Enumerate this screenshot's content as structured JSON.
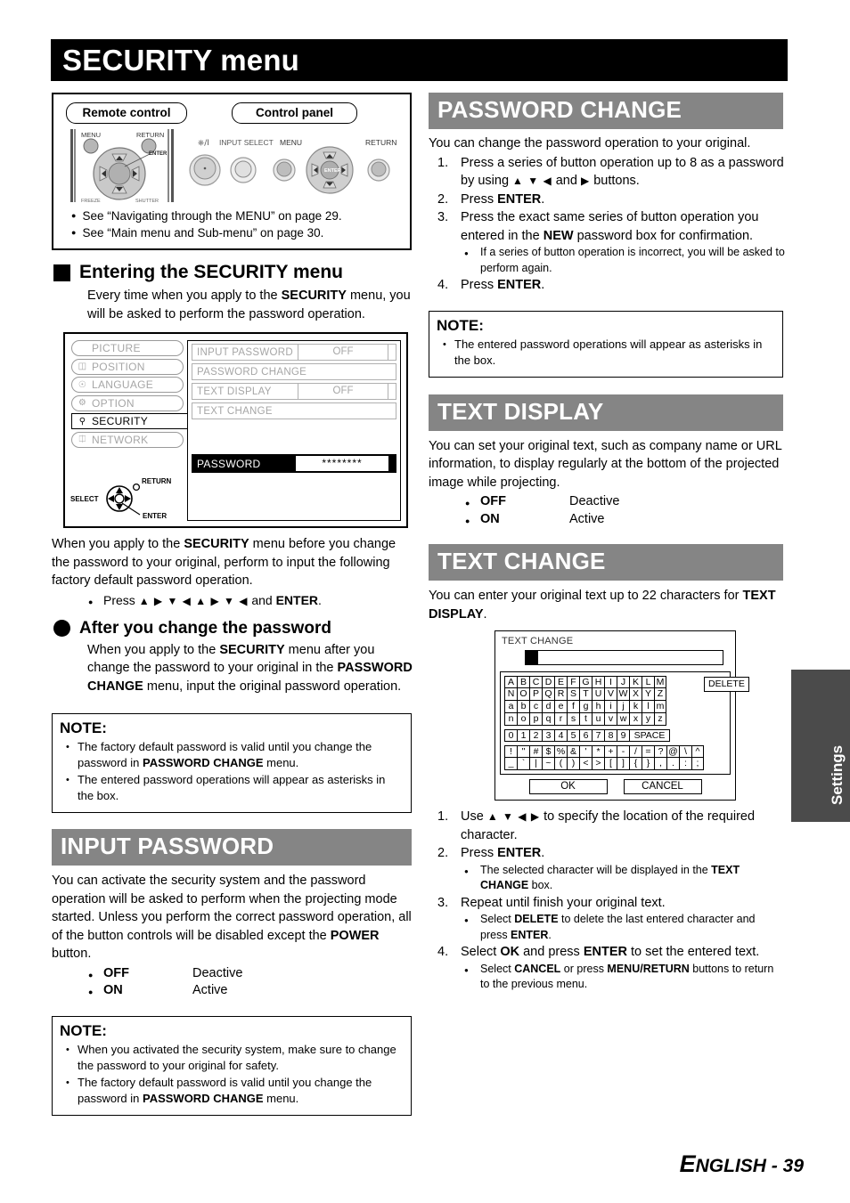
{
  "page": {
    "title": "SECURITY menu",
    "footer_lead": "E",
    "footer_rest": "NGLISH - 39",
    "side_tab": "Settings"
  },
  "control_figure": {
    "remote_label": "Remote control",
    "panel_label": "Control panel",
    "remote_buttons": [
      "MENU",
      "RETURN",
      "ENTER"
    ],
    "panel_labels": [
      "INPUT SELECT",
      "MENU",
      "RETURN"
    ],
    "panel_power_icon": "power-standby-icon",
    "bullets": [
      "See “Navigating through the MENU” on page 29.",
      "See “Main menu and Sub-menu” on page 30."
    ]
  },
  "entering": {
    "heading": "Entering the SECURITY menu",
    "intro_parts": [
      "Every time when you apply to the ",
      "SECURITY",
      " menu, you will be asked to perform the password operation."
    ]
  },
  "osd": {
    "sidebar": [
      {
        "label": "PICTURE",
        "icon": "",
        "selected": false
      },
      {
        "label": "POSITION",
        "icon": "position-icon",
        "selected": false
      },
      {
        "label": "LANGUAGE",
        "icon": "globe-icon",
        "selected": false
      },
      {
        "label": "OPTION",
        "icon": "option-icon",
        "selected": false
      },
      {
        "label": "SECURITY",
        "icon": "key-icon",
        "selected": true
      },
      {
        "label": "NETWORK",
        "icon": "network-icon",
        "selected": false
      }
    ],
    "rows": [
      {
        "label": "INPUT PASSWORD",
        "value": "OFF"
      },
      {
        "label": "PASSWORD CHANGE",
        "value": ""
      },
      {
        "label": "TEXT DISPLAY",
        "value": "OFF"
      },
      {
        "label": "TEXT CHANGE",
        "value": ""
      }
    ],
    "password_row": {
      "label": "PASSWORD",
      "value": "********"
    },
    "nav_hint": {
      "select": "SELECT",
      "return": "RETURN",
      "enter": "ENTER"
    }
  },
  "before_change": {
    "paragraph_parts": [
      "When you apply to the ",
      "SECURITY",
      " menu before you change the password to your original, perform to input the following factory default password operation."
    ],
    "press_prefix": "Press ",
    "press_arrows": "▲ ▶ ▼ ◀ ▲ ▶ ▼ ◀",
    "press_suffix": " and ",
    "press_key": "ENTER",
    "press_end": "."
  },
  "after_change": {
    "heading": "After you change the password",
    "parts": [
      "When you apply to the ",
      "SECURITY",
      " menu after you change the password to your original in the ",
      "PASSWORD CHANGE",
      " menu, input the original password operation."
    ]
  },
  "note_left_1": {
    "title": "NOTE:",
    "items": [
      {
        "parts": [
          "The factory default password is valid until you change the password in ",
          "PASSWORD CHANGE",
          " menu."
        ]
      },
      {
        "parts": [
          "The entered password operations will appear as asterisks in the box."
        ]
      }
    ]
  },
  "input_password": {
    "heading": "INPUT PASSWORD",
    "body_parts": [
      "You can activate the security system and the password operation will be asked to perform when the projecting mode started. Unless you perform the correct password operation, all of the button controls will be disabled except the ",
      "POWER",
      " button."
    ],
    "options": [
      {
        "key": "OFF",
        "value": "Deactive"
      },
      {
        "key": "ON",
        "value": "Active"
      }
    ]
  },
  "note_left_2": {
    "title": "NOTE:",
    "items": [
      {
        "parts": [
          "When you activated the security system, make sure to change the password to your original for safety."
        ]
      },
      {
        "parts": [
          "The factory default password is valid until you change the password in ",
          "PASSWORD CHANGE",
          " menu."
        ]
      }
    ]
  },
  "password_change": {
    "heading": "PASSWORD CHANGE",
    "intro": "You can change the password operation to your original.",
    "steps": [
      {
        "num": "1.",
        "parts": [
          "Press a series of button operation up to 8 as a password by using ",
          "▲ ▼ ◀",
          " and ",
          "▶",
          " buttons."
        ],
        "sub": []
      },
      {
        "num": "2.",
        "parts": [
          "Press ",
          "ENTER",
          "."
        ],
        "sub": []
      },
      {
        "num": "3.",
        "parts": [
          "Press the exact same series of button operation you entered in the ",
          "NEW",
          " password box for confirmation."
        ],
        "sub": [
          "If a series of button operation is incorrect, you will be asked to perform again."
        ]
      },
      {
        "num": "4.",
        "parts": [
          "Press ",
          "ENTER",
          "."
        ],
        "sub": []
      }
    ]
  },
  "note_right_1": {
    "title": "NOTE:",
    "items": [
      {
        "parts": [
          "The entered password operations will appear as asterisks in the box."
        ]
      }
    ]
  },
  "text_display": {
    "heading": "TEXT DISPLAY",
    "body": "You can set your original text, such as company name or URL information, to display regularly at the bottom of the projected image while projecting.",
    "options": [
      {
        "key": "OFF",
        "value": "Deactive"
      },
      {
        "key": "ON",
        "value": "Active"
      }
    ]
  },
  "text_change": {
    "heading": "TEXT CHANGE",
    "body_parts": [
      "You can enter your original text up to 22 characters for ",
      "TEXT DISPLAY",
      "."
    ],
    "dialog": {
      "title": "TEXT CHANGE",
      "input_value": "",
      "delete_label": "DELETE",
      "ok_label": "OK",
      "cancel_label": "CANCEL",
      "keyboard": {
        "letters": [
          [
            "A",
            "B",
            "C",
            "D",
            "E",
            "F",
            "G",
            "H",
            "I",
            "J",
            "K",
            "L",
            "M"
          ],
          [
            "N",
            "O",
            "P",
            "Q",
            "R",
            "S",
            "T",
            "U",
            "V",
            "W",
            "X",
            "Y",
            "Z"
          ],
          [
            "a",
            "b",
            "c",
            "d",
            "e",
            "f",
            "g",
            "h",
            "i",
            "j",
            "k",
            "l",
            "m"
          ],
          [
            "n",
            "o",
            "p",
            "q",
            "r",
            "s",
            "t",
            "u",
            "v",
            "w",
            "x",
            "y",
            "z"
          ]
        ],
        "digits": [
          "0",
          "1",
          "2",
          "3",
          "4",
          "5",
          "6",
          "7",
          "8",
          "9"
        ],
        "space_label": "SPACE",
        "symbols": [
          [
            "!",
            "\"",
            "#",
            "$",
            "%",
            "&",
            "'",
            "*",
            "+",
            "-",
            "/",
            "=",
            "?",
            "@",
            "\\",
            "^"
          ],
          [
            "_",
            "`",
            "|",
            "~",
            "(",
            ")",
            "<",
            ">",
            "[",
            "]",
            "{",
            "}",
            ",",
            ".",
            ":",
            ";"
          ]
        ]
      }
    },
    "steps": [
      {
        "num": "1.",
        "parts": [
          "Use ",
          "▲ ▼ ◀ ▶",
          " to specify the location of the required character."
        ],
        "sub": []
      },
      {
        "num": "2.",
        "parts": [
          "Press ",
          "ENTER",
          "."
        ],
        "sub": [
          "The selected character will be displayed in the TEXT CHANGE box."
        ]
      },
      {
        "num": "3.",
        "parts": [
          "Repeat until finish your original text."
        ],
        "sub": [
          "Select DELETE to delete the last entered character and press ENTER."
        ]
      },
      {
        "num": "4.",
        "parts": [
          "Select ",
          "OK",
          " and press ",
          "ENTER",
          " to set the entered text."
        ],
        "sub": [
          "Select CANCEL or press MENU/RETURN buttons to return to the previous menu."
        ]
      }
    ]
  },
  "colors": {
    "title_bar": "#000000",
    "section_heading_bg": "#858585",
    "side_tab_bg": "#4b4b4b",
    "osd_dim_text": "#a6a6a6"
  }
}
